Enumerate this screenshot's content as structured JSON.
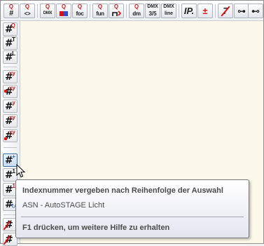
{
  "toolbar": {
    "items": [
      {
        "name": "hash-q-button",
        "top": "Q",
        "bottom": "#"
      },
      {
        "name": "compare-q-button",
        "top": "Q",
        "bottom": "<>"
      },
      {
        "name": "dmx-q-button",
        "top": "Q",
        "bottom": "DMX"
      },
      {
        "name": "color-q-button",
        "top": "Q",
        "bottom": ""
      },
      {
        "name": "focus-q-button",
        "top": "Q",
        "bottom": "foc"
      },
      {
        "name": "function-q-button",
        "top": "Q",
        "bottom": "fun"
      },
      {
        "name": "position-q-button",
        "top": "Q",
        "bottom": ""
      },
      {
        "name": "dimmer-q-button",
        "top": "Q",
        "bottom": "dm"
      },
      {
        "name": "dmx-35-button",
        "top": "DMX",
        "bottom": "3/5"
      },
      {
        "name": "dmx-line-button",
        "top": "DMX",
        "bottom": "line"
      },
      {
        "name": "ip-button",
        "glyph": "IP."
      },
      {
        "name": "insert-point-button",
        "glyph": "±"
      },
      {
        "name": "strike-button",
        "glyph": "7"
      },
      {
        "name": "truss-button-a",
        "glyph": "⊶"
      },
      {
        "name": "truss-button-b",
        "glyph": "⊷"
      }
    ]
  },
  "sidebar": {
    "buttons": [
      {
        "name": "index-q-button",
        "sup": "Q"
      },
      {
        "name": "index-t-button",
        "sup": "T"
      },
      {
        "name": "index-l-button",
        "sup": "L"
      },
      {
        "name": "index-xy-button",
        "sup": "xy"
      },
      {
        "name": "index-xy-dot-button",
        "sup": "xy"
      },
      {
        "name": "index-y-button",
        "sup": "y"
      },
      {
        "name": "index-xy2-button",
        "sup": "xy"
      },
      {
        "name": "index-xy-dot2-button",
        "sup": "xy"
      },
      {
        "name": "index-selection-order-button",
        "sup": "+"
      },
      {
        "name": "index-1-button",
        "sup": "1"
      },
      {
        "name": "index-1b-button",
        "sup": "1"
      },
      {
        "name": "index-rotate-button",
        "sup": ""
      },
      {
        "name": "index-delete-button",
        "sup": ""
      },
      {
        "name": "index-delete2-button",
        "sup": ""
      }
    ]
  },
  "tooltip": {
    "title": "Indexnummer vergeben nach Reihenfolge der Auswahl",
    "description": "ASN - AutoSTAGE Licht",
    "help": "F1 drücken, um weitere Hilfe zu erhalten"
  }
}
